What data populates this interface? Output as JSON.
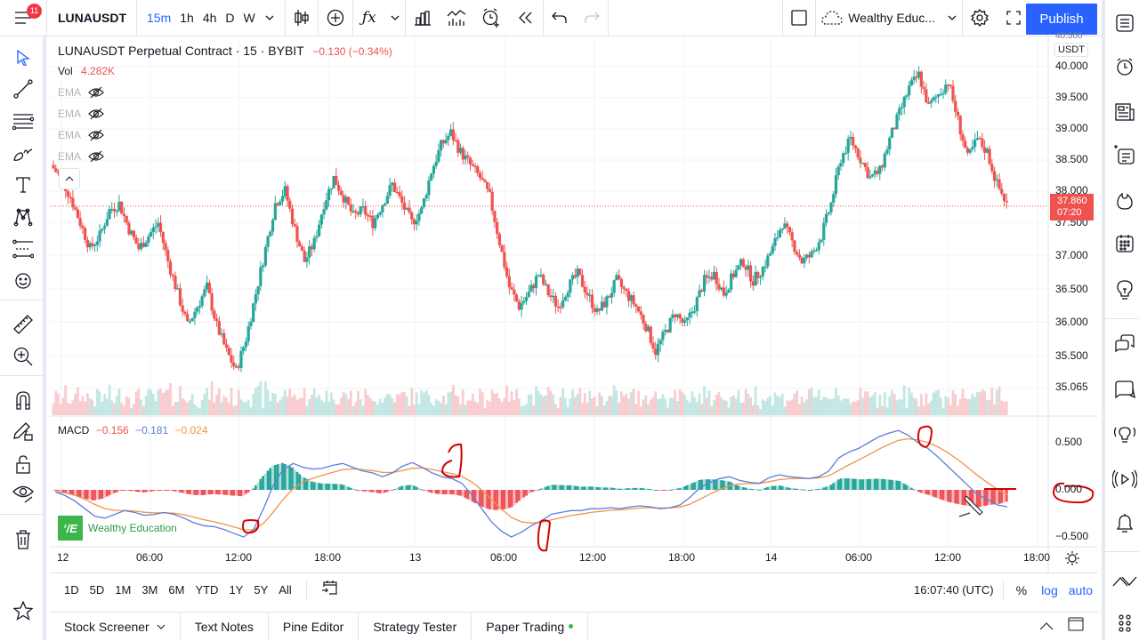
{
  "topbar": {
    "notification_count": "11",
    "symbol": "LUNAUSDT",
    "intervals": [
      "15m",
      "1h",
      "4h",
      "D",
      "W"
    ],
    "active_interval": "15m",
    "layout_name": "Wealthy Educ...",
    "publish_label": "Publish"
  },
  "legend": {
    "title": "LUNAUSDT Perpetual Contract · 15 · BYBIT",
    "change": "−0.130 (−0.34%)",
    "vol_label": "Vol",
    "vol_value": "4.282K",
    "ema_label": "EMA",
    "ema_count": 4
  },
  "price_axis": {
    "currency": "USDT",
    "top_partial": "40.500",
    "labels": [
      "40.000",
      "39.500",
      "39.000",
      "38.500",
      "38.000",
      "37.500",
      "37.000",
      "36.500",
      "36.000",
      "35.500",
      "35.065"
    ],
    "last_price": "37.860",
    "countdown": "07:20"
  },
  "macd": {
    "label": "MACD",
    "hist": "−0.156",
    "macd": "−0.181",
    "signal": "−0.024",
    "axis_labels": [
      "0.500",
      "0.000",
      "−0.500"
    ]
  },
  "time_axis": [
    "12",
    "06:00",
    "12:00",
    "18:00",
    "13",
    "06:00",
    "12:00",
    "18:00",
    "14",
    "06:00",
    "12:00",
    "18:00"
  ],
  "watermark": "Wealthy Education",
  "rangebar": {
    "ranges": [
      "1D",
      "5D",
      "1M",
      "3M",
      "6M",
      "YTD",
      "1Y",
      "5Y",
      "All"
    ],
    "clock": "16:07:40 (UTC)",
    "percent": "%",
    "log": "log",
    "auto": "auto"
  },
  "panels": [
    "Stock Screener",
    "Text Notes",
    "Pine Editor",
    "Strategy Tester",
    "Paper Trading"
  ],
  "colors": {
    "up": "#26a69a",
    "down": "#ef5350",
    "accent": "#2962ff",
    "macd_line": "#5b7fdb",
    "signal_line": "#f0944a",
    "annotation": "#d40000"
  },
  "chart_data": {
    "type": "candlestick",
    "title": "LUNAUSDT Perpetual Contract · 15 · BYBIT",
    "ylim": [
      35.0,
      40.6
    ],
    "price_path": [
      38.5,
      38.3,
      38.0,
      37.6,
      37.2,
      37.4,
      37.8,
      37.9,
      37.5,
      37.2,
      37.4,
      37.6,
      37.0,
      36.5,
      36.0,
      36.3,
      36.6,
      36.0,
      35.6,
      35.3,
      35.8,
      36.5,
      37.2,
      37.9,
      38.1,
      37.5,
      37.0,
      37.3,
      37.9,
      38.3,
      38.0,
      37.7,
      37.8,
      37.6,
      37.9,
      38.2,
      37.9,
      37.6,
      37.8,
      38.4,
      38.8,
      39.0,
      38.7,
      38.5,
      38.3,
      38.0,
      37.3,
      36.6,
      36.3,
      36.5,
      36.8,
      36.5,
      36.3,
      36.6,
      36.8,
      36.5,
      36.2,
      36.4,
      36.7,
      36.5,
      36.3,
      36.0,
      35.6,
      35.9,
      36.2,
      36.0,
      36.3,
      36.7,
      36.8,
      36.5,
      36.8,
      37.0,
      36.7,
      36.9,
      37.2,
      37.6,
      37.3,
      37.0,
      37.1,
      37.4,
      37.9,
      38.6,
      38.9,
      38.6,
      38.3,
      38.4,
      38.9,
      39.3,
      39.7,
      39.9,
      39.4,
      39.6,
      39.8,
      39.2,
      38.6,
      38.9,
      38.7,
      38.2,
      37.9
    ],
    "macd_series": [
      -0.02,
      -0.06,
      -0.12,
      -0.2,
      -0.28,
      -0.3,
      -0.26,
      -0.22,
      -0.24,
      -0.27,
      -0.26,
      -0.24,
      -0.26,
      -0.3,
      -0.35,
      -0.38,
      -0.39,
      -0.42,
      -0.46,
      -0.5,
      -0.42,
      -0.2,
      0.05,
      0.22,
      0.28,
      0.24,
      0.22,
      0.23,
      0.26,
      0.28,
      0.24,
      0.2,
      0.18,
      0.14,
      0.18,
      0.25,
      0.29,
      0.24,
      0.18,
      0.14,
      0.12,
      0.07,
      -0.05,
      -0.2,
      -0.34,
      -0.44,
      -0.5,
      -0.45,
      -0.38,
      -0.33,
      -0.26,
      -0.24,
      -0.22,
      -0.22,
      -0.2,
      -0.2,
      -0.19,
      -0.2,
      -0.18,
      -0.17,
      -0.18,
      -0.2,
      -0.19,
      -0.16,
      -0.08,
      0.02,
      0.08,
      0.12,
      0.14,
      0.1,
      0.08,
      0.07,
      0.13,
      0.16,
      0.14,
      0.13,
      0.12,
      0.14,
      0.2,
      0.34,
      0.4,
      0.44,
      0.5,
      0.56,
      0.6,
      0.63,
      0.58,
      0.5,
      0.44,
      0.35,
      0.25,
      0.15,
      0.05,
      -0.05,
      -0.1,
      -0.16,
      -0.18
    ],
    "time_ticks": [
      "12",
      "06:00",
      "12:00",
      "18:00",
      "13",
      "06:00",
      "12:00",
      "18:00",
      "14",
      "06:00",
      "12:00",
      "18:00"
    ]
  }
}
